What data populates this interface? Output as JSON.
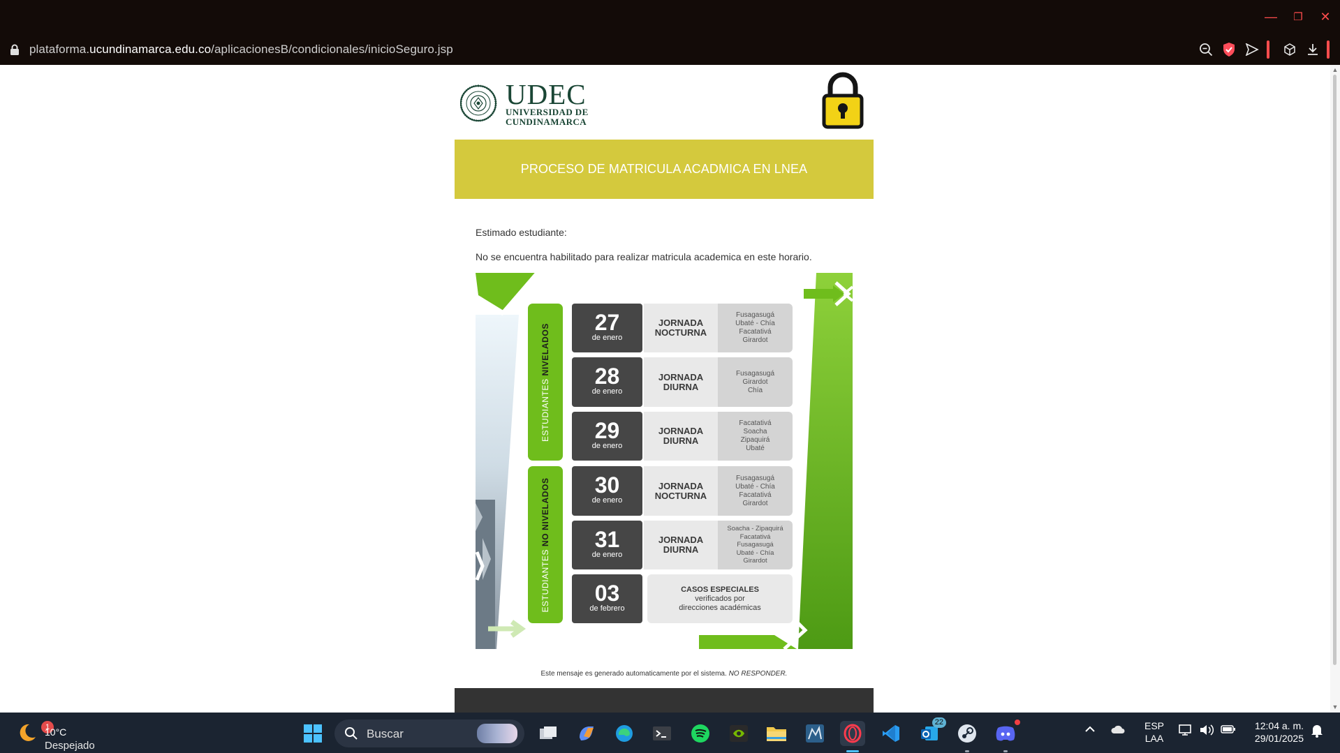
{
  "window": {
    "minimize_label": "—",
    "restore_label": "❐",
    "close_label": "✕"
  },
  "address_bar": {
    "url_prefix": "plataforma.",
    "url_domain": "ucundinamarca.edu.co",
    "url_path": "/aplicacionesB/condicionales/inicioSeguro.jsp"
  },
  "header": {
    "brand_big": "UDEC",
    "brand_line1": "UNIVERSIDAD DE",
    "brand_line2": "CUNDINAMARCA",
    "seal_text": "UNIVERSIDAD DE CUNDINAMARCA"
  },
  "banner": {
    "title": "PROCESO DE MATRICULA ACADMICA EN LNEA"
  },
  "body": {
    "greeting": "Estimado estudiante:",
    "message": "No se encuentra habilitado para realizar matricula academica en este horario."
  },
  "schedule": {
    "group_nivelados": {
      "prefix": "ESTUDIANTES ",
      "bold": "NIVELADOS"
    },
    "group_no_nivelados": {
      "prefix": "ESTUDIANTES ",
      "bold": "NO NIVELADOS"
    },
    "rows": [
      {
        "day": "27",
        "month": "de enero",
        "shift1": "JORNADA",
        "shift2": "NOCTURNA",
        "cities": [
          "Fusagasugá",
          "Ubaté - Chía",
          "Facatativá",
          "Girardot"
        ]
      },
      {
        "day": "28",
        "month": "de enero",
        "shift1": "JORNADA",
        "shift2": "DIURNA",
        "cities": [
          "Fusagasugá",
          "Girardot",
          "Chía"
        ]
      },
      {
        "day": "29",
        "month": "de enero",
        "shift1": "JORNADA",
        "shift2": "DIURNA",
        "cities": [
          "Facatativá",
          "Soacha",
          "Zipaquirá",
          "Ubaté"
        ]
      },
      {
        "day": "30",
        "month": "de enero",
        "shift1": "JORNADA",
        "shift2": "NOCTURNA",
        "cities": [
          "Fusagasugá",
          "Ubaté - Chía",
          "Facatativá",
          "Girardot"
        ]
      },
      {
        "day": "31",
        "month": "de enero",
        "shift1": "JORNADA",
        "shift2": "DIURNA",
        "cities": [
          "Soacha - Zipaquirá",
          "Facatativá",
          "Fusagasugá",
          "Ubaté - Chía",
          "Girardot"
        ]
      }
    ],
    "special": {
      "day": "03",
      "month": "de febrero",
      "title": "CASOS ESPECIALES",
      "line1": "verificados por",
      "line2": "direcciones académicas"
    }
  },
  "footer": {
    "note": "Este mensaje es generado automaticamente por el sistema. ",
    "note_emph": "NO RESPONDER."
  },
  "taskbar": {
    "weather_temp": "10°C",
    "weather_condition": "Despejado",
    "weather_badge": "1",
    "search_placeholder": "Buscar",
    "outlook_badge": "22",
    "language": "ESP",
    "layout": "LAA",
    "time": "12:04 a. m.",
    "date": "29/01/2025"
  },
  "colors": {
    "banner": "#d4c93d",
    "brand_green": "#1a4635",
    "schedule_green": "#6fbd1c",
    "day_cell": "#464646",
    "chrome_bg": "#130b08",
    "taskbar_bg": "#1b2431"
  }
}
